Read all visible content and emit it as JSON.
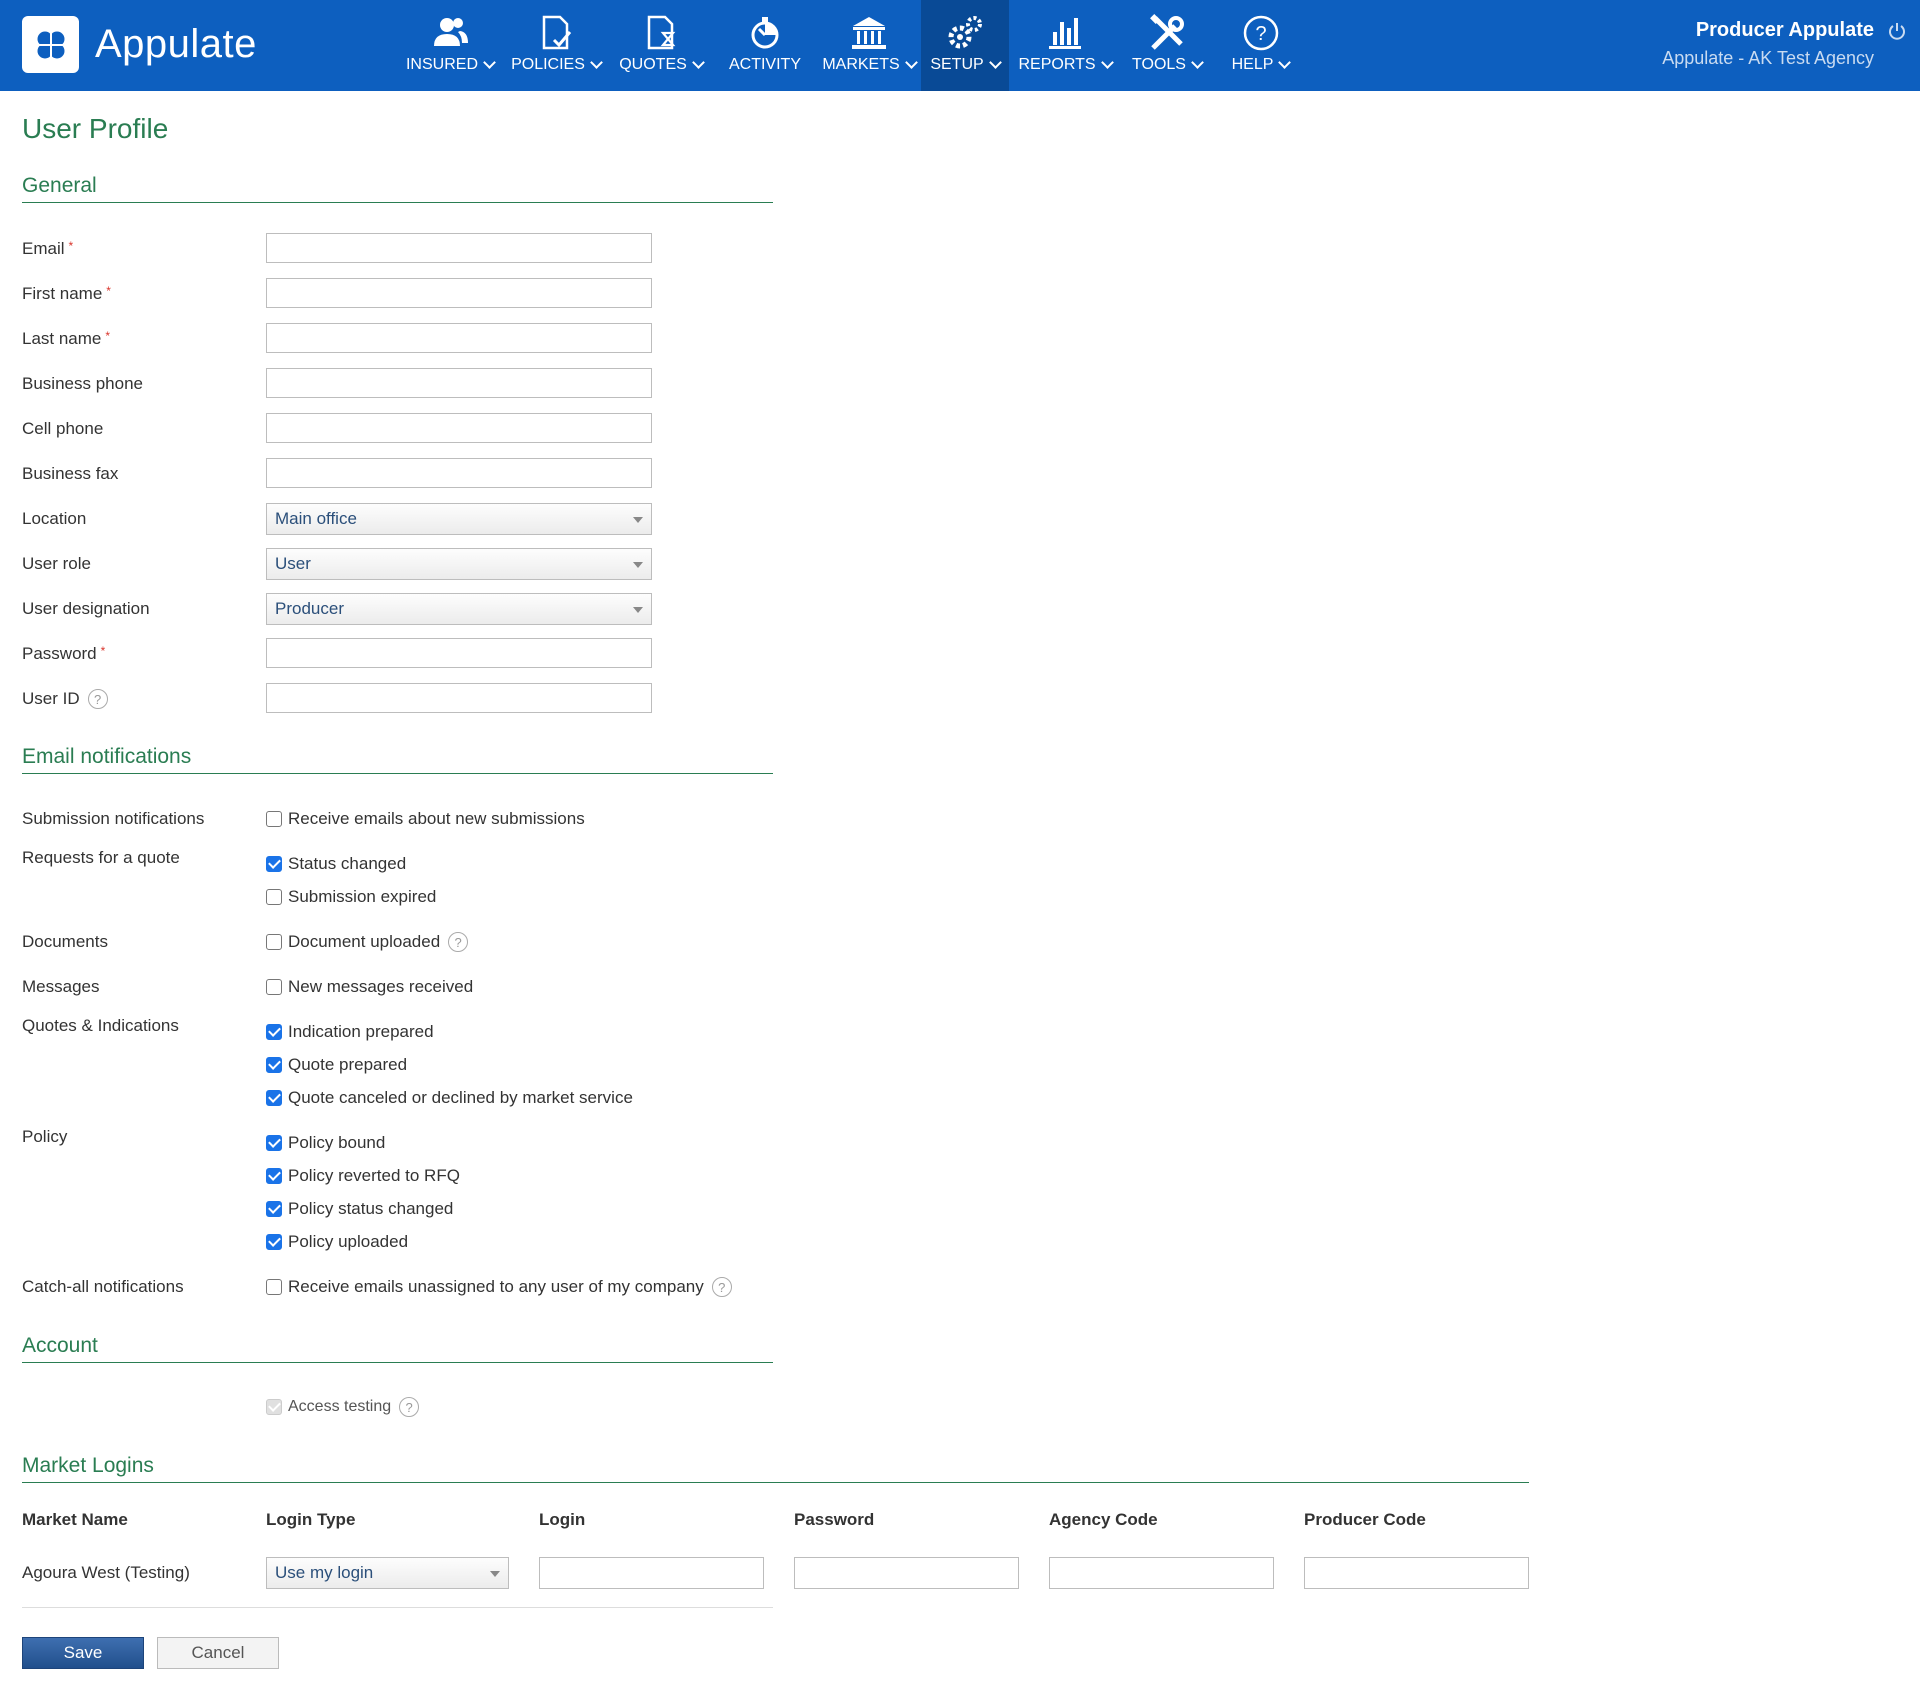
{
  "app": {
    "name": "Appulate"
  },
  "nav": [
    {
      "label": "INSURED",
      "icon": "insured-icon",
      "dropdown": true
    },
    {
      "label": "POLICIES",
      "icon": "policies-icon",
      "dropdown": true
    },
    {
      "label": "QUOTES",
      "icon": "quotes-icon",
      "dropdown": true
    },
    {
      "label": "ACTIVITY",
      "icon": "activity-icon",
      "dropdown": false
    },
    {
      "label": "MARKETS",
      "icon": "markets-icon",
      "dropdown": true
    },
    {
      "label": "SETUP",
      "icon": "setup-icon",
      "dropdown": true,
      "active": true
    },
    {
      "label": "REPORTS",
      "icon": "reports-icon",
      "dropdown": true
    },
    {
      "label": "TOOLS",
      "icon": "tools-icon",
      "dropdown": true
    },
    {
      "label": "HELP",
      "icon": "help-icon",
      "dropdown": true
    }
  ],
  "user": {
    "name": "Producer Appulate",
    "agency": "Appulate - AK Test Agency"
  },
  "page": {
    "title": "User Profile"
  },
  "general": {
    "heading": "General",
    "email": {
      "label": "Email",
      "value": ""
    },
    "first_name": {
      "label": "First name",
      "value": ""
    },
    "last_name": {
      "label": "Last name",
      "value": ""
    },
    "business_phone": {
      "label": "Business phone",
      "value": ""
    },
    "cell_phone": {
      "label": "Cell phone",
      "value": ""
    },
    "business_fax": {
      "label": "Business fax",
      "value": ""
    },
    "location": {
      "label": "Location",
      "value": "Main office"
    },
    "user_role": {
      "label": "User role",
      "value": "User"
    },
    "user_designation": {
      "label": "User designation",
      "value": "Producer"
    },
    "password": {
      "label": "Password",
      "value": ""
    },
    "user_id": {
      "label": "User ID",
      "value": ""
    },
    "required_mark": "*",
    "help_mark": "?"
  },
  "notifications": {
    "heading": "Email notifications",
    "submission": {
      "label": "Submission notifications",
      "options": [
        {
          "text": "Receive emails about new submissions",
          "checked": false
        }
      ]
    },
    "rfq": {
      "label": "Requests for a quote",
      "options": [
        {
          "text": "Status changed",
          "checked": true
        },
        {
          "text": "Submission expired",
          "checked": false
        }
      ]
    },
    "documents": {
      "label": "Documents",
      "options": [
        {
          "text": "Document uploaded",
          "checked": false
        }
      ]
    },
    "messages": {
      "label": "Messages",
      "options": [
        {
          "text": "New messages received",
          "checked": false
        }
      ]
    },
    "quotes": {
      "label": "Quotes & Indications",
      "options": [
        {
          "text": "Indication prepared",
          "checked": true
        },
        {
          "text": "Quote prepared",
          "checked": true
        },
        {
          "text": "Quote canceled or declined by market service",
          "checked": true
        }
      ]
    },
    "policy": {
      "label": "Policy",
      "options": [
        {
          "text": "Policy bound",
          "checked": true
        },
        {
          "text": "Policy reverted to RFQ",
          "checked": true
        },
        {
          "text": "Policy status changed",
          "checked": true
        },
        {
          "text": "Policy uploaded",
          "checked": true
        }
      ]
    },
    "catchall": {
      "label": "Catch-all notifications",
      "options": [
        {
          "text": "Receive emails unassigned to any user of my company",
          "checked": false
        }
      ]
    }
  },
  "account": {
    "heading": "Account",
    "access_testing": {
      "text": "Access testing",
      "checked": true,
      "disabled": true
    }
  },
  "market_logins": {
    "heading": "Market Logins",
    "columns": [
      "Market Name",
      "Login Type",
      "Login",
      "Password",
      "Agency Code",
      "Producer Code"
    ],
    "rows": [
      {
        "market": "Agoura West (Testing)",
        "login_type": "Use my login",
        "login": "",
        "password": "",
        "agency_code": "",
        "producer_code": ""
      }
    ]
  },
  "actions": {
    "save": "Save",
    "cancel": "Cancel"
  },
  "colors": {
    "header": "#0d5fbf",
    "active_nav": "#094a96",
    "section": "#2a7d52",
    "checkbox": "#1a73e8"
  }
}
